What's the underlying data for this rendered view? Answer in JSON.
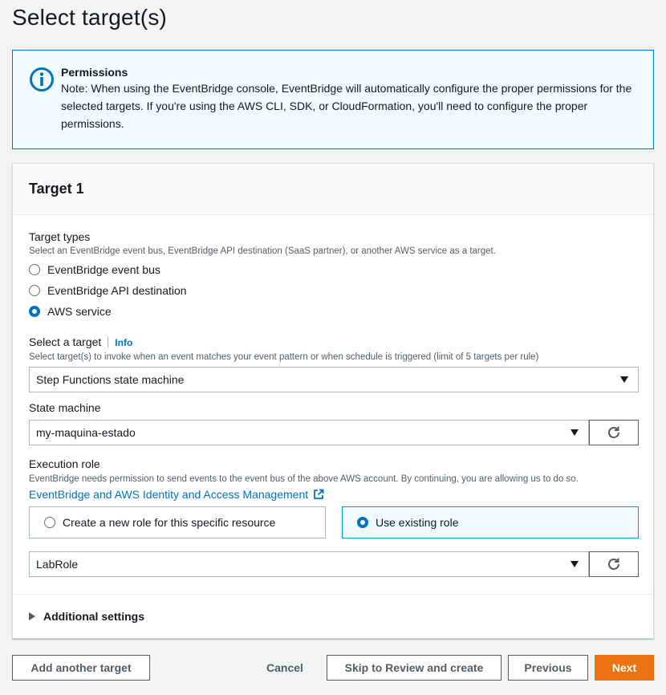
{
  "page": {
    "title": "Select target(s)"
  },
  "alert": {
    "title": "Permissions",
    "body": "Note: When using the EventBridge console, EventBridge will automatically configure the proper permissions for the selected targets. If you're using the AWS CLI, SDK, or CloudFormation, you'll need to configure the proper permissions.",
    "icon": "info-circle-icon"
  },
  "target": {
    "header": "Target 1",
    "types": {
      "label": "Target types",
      "description": "Select an EventBridge event bus, EventBridge API destination (SaaS partner), or another AWS service as a target.",
      "options": [
        "EventBridge event bus",
        "EventBridge API destination",
        "AWS service"
      ],
      "selected": "AWS service"
    },
    "select_target": {
      "label": "Select a target",
      "info": "Info",
      "description": "Select target(s) to invoke when an event matches your event pattern or when schedule is triggered (limit of 5 targets per rule)",
      "value": "Step Functions state machine"
    },
    "state_machine": {
      "label": "State machine",
      "value": "my-maquina-estado"
    },
    "execution_role": {
      "label": "Execution role",
      "description": "EventBridge needs permission to send events to the event bus of the above AWS account. By continuing, you are allowing us to do so.",
      "link": "EventBridge and AWS Identity and Access Management",
      "options": [
        "Create a new role for this specific resource",
        "Use existing role"
      ],
      "selected": "Use existing role",
      "role_value": "LabRole"
    },
    "additional_settings": "Additional settings"
  },
  "footer": {
    "add_target": "Add another target",
    "cancel": "Cancel",
    "skip": "Skip to Review and create",
    "previous": "Previous",
    "next": "Next"
  },
  "colors": {
    "accent": "#0073bb",
    "primary_button": "#ec7211",
    "alert_bg": "#f1faff"
  }
}
